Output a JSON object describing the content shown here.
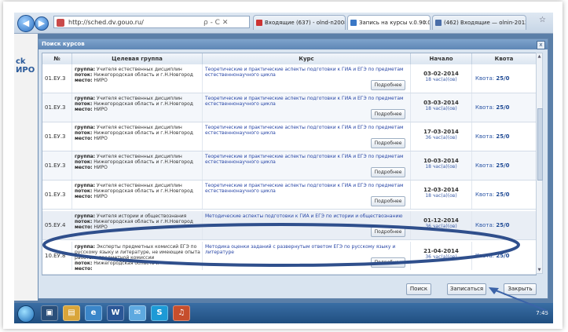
{
  "browser": {
    "address": "http://sched.dv.gouo.ru/",
    "address_tools": "ρ - C ✕",
    "tabs": [
      {
        "label": "Входящие (637) - olnd-n2008@..."
      },
      {
        "label": "Запись на курсы v.0.90.0 b..."
      },
      {
        "label": "(462) Входящие — olnin-2012..."
      }
    ]
  },
  "page": {
    "logo": "ck\nИРО"
  },
  "dialog": {
    "title": "Поиск курсов",
    "close_label": "x",
    "columns": {
      "num": "№",
      "group": "Целевая группа",
      "course": "Курс",
      "start": "Начало",
      "quota": "Квота"
    },
    "group_labels": {
      "group": "группа:",
      "stream": "поток:",
      "place": "место:"
    },
    "more_label": "Подробнее",
    "quota_label": "Квота:",
    "rows": [
      {
        "num": "01.ЕУ.3",
        "group": "Учителя естественных дисциплин",
        "stream": "Нижегородская область и г.Н.Новгород",
        "place": "НИРО",
        "course": "Теоретические и практические аспекты подготовки к ГИА и ЕГЭ по предметам естественнонаучного цикла",
        "date": "03-02-2014",
        "hours": "18 час(а)(ов)",
        "quota": "25/0"
      },
      {
        "num": "01.ЕУ.3",
        "group": "Учителя естественных дисциплин",
        "stream": "Нижегородская область и г.Н.Новгород",
        "place": "НИРО",
        "course": "Теоретические и практические аспекты подготовки к ГИА и ЕГЭ по предметам естественнонаучного цикла",
        "date": "03-03-2014",
        "hours": "18 час(а)(ов)",
        "quota": "25/0"
      },
      {
        "num": "01.ЕУ.3",
        "group": "Учителя естественных дисциплин",
        "stream": "Нижегородская область и г.Н.Новгород",
        "place": "НИРО",
        "course": "Теоретические и практические аспекты подготовки к ГИА и ЕГЭ по предметам естественнонаучного цикла",
        "date": "17-03-2014",
        "hours": "36 час(а)(ов)",
        "quota": "25/0"
      },
      {
        "num": "01.ЕУ.3",
        "group": "Учителя естественных дисциплин",
        "stream": "Нижегородская область и г.Н.Новгород",
        "place": "НИРО",
        "course": "Теоретические и практические аспекты подготовки к ГИА и ЕГЭ по предметам естественнонаучного цикла",
        "date": "10-03-2014",
        "hours": "18 час(а)(ов)",
        "quota": "25/0"
      },
      {
        "num": "01.ЕУ.3",
        "group": "Учителя естественных дисциплин",
        "stream": "Нижегородская область и г.Н.Новгород",
        "place": "НИРО",
        "course": "Теоретические и практические аспекты подготовки к ГИА и ЕГЭ по предметам естественнонаучного цикла",
        "date": "12-03-2014",
        "hours": "18 час(а)(ов)",
        "quota": "25/0"
      },
      {
        "num": "05.ЕУ.4",
        "group": "Учителя истории и обществознания",
        "stream": "Нижегородская область и г.Н.Новгород",
        "place": "НИРО",
        "course": "Методические аспекты подготовки к ГИА и ЕГЭ по истории и обществознанию",
        "date": "01-12-2014",
        "hours": "36 час(а)(ов)",
        "quota": "25/0"
      },
      {
        "num": "10.ЕУ.8",
        "group": "Эксперты предметных комиссий ЕГЭ по русскому языку и литературе, не имеющие опыта работы в предметной комиссии",
        "stream": "Нижегородская область и",
        "place": "",
        "course": "Методика оценки заданий с развернутым ответом ЕГЭ по русскому языку и литературе",
        "date": "21-04-2014",
        "hours": "36 час(а)(ов)",
        "quota": "25/0"
      }
    ],
    "buttons": {
      "search": "Поиск",
      "enroll": "Записаться",
      "close": "Закрыть"
    }
  },
  "taskbar": {
    "clock": "7:45"
  },
  "colors": {
    "annotation": "#2f4f8c",
    "dialog_title": "#6b93c2",
    "link": "#2846a6"
  }
}
